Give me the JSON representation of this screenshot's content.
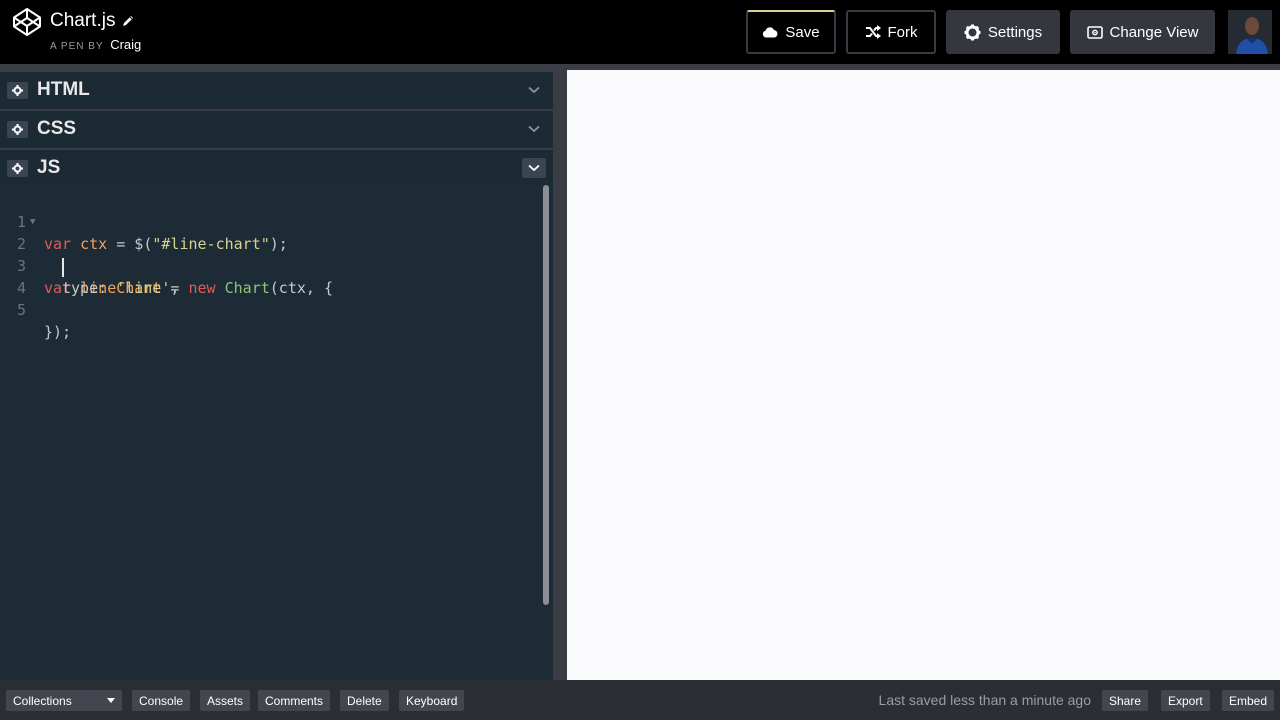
{
  "header": {
    "pen_title": "Chart.js",
    "pen_by_prefix": "A PEN BY",
    "author": "Craig",
    "save_label": "Save",
    "fork_label": "Fork",
    "settings_label": "Settings",
    "change_view_label": "Change View"
  },
  "panels": {
    "html_title": "HTML",
    "css_title": "CSS",
    "js_title": "JS"
  },
  "code": {
    "line_numbers": [
      "1",
      "2",
      "3",
      "4",
      "5"
    ],
    "line1": {
      "kw": "var",
      "v": "ctx",
      "op": " = $(",
      "str": "\"#line-chart\"",
      "end": ");"
    },
    "line2": {
      "kw": "var",
      "v": "lineChart",
      "op": " = ",
      "kw2": "new",
      "cls": "Chart",
      "end": "(ctx, {"
    },
    "line3": {
      "prop": "type: ",
      "str": "'line'",
      "end": ","
    },
    "line5": {
      "text": "});"
    }
  },
  "footer": {
    "collections_label": "Collections",
    "console_label": "Console",
    "assets_label": "Assets",
    "comments_label": "Comments",
    "delete_label": "Delete",
    "keyboard_label": "Keyboard",
    "last_saved": "Last saved less than a minute ago",
    "share_label": "Share",
    "export_label": "Export",
    "embed_label": "Embed"
  }
}
